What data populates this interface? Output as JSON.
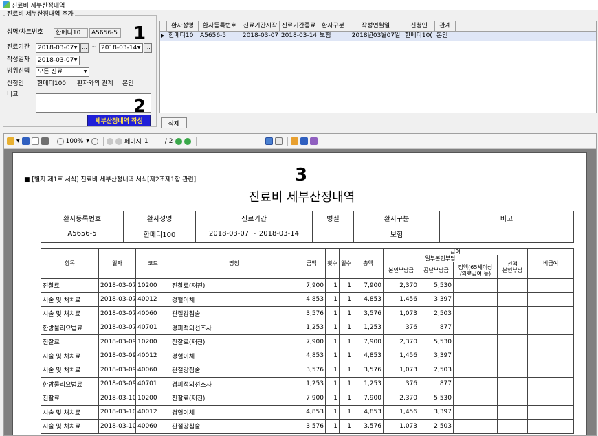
{
  "window": {
    "title": "진료비 세부산정내역"
  },
  "group": {
    "title": "진료비 세부산정내역 추가"
  },
  "form": {
    "name_label": "성명/차트번호",
    "name_value": "한메디10",
    "chart_value": "A5656-5",
    "period_label": "진료기간",
    "period_start": "2018-03-07",
    "period_sep": "~",
    "period_end": "2018-03-14",
    "ellipsis": "...",
    "write_date_label": "작성일자",
    "write_date": "2018-03-07",
    "scope_label": "범위선택",
    "scope_value": "모든 진료",
    "applicant_label": "신청인",
    "applicant_value": "한메디100",
    "relation_label": "환자와의 관계",
    "relation_value": "본인",
    "remark_label": "비고",
    "create_button": "세부산정내역 작성"
  },
  "markers": {
    "m1": "1",
    "m2": "2",
    "m3": "3"
  },
  "grid": {
    "headers": [
      "환자성명",
      "환자등록번호",
      "진료기간시작",
      "진료기간종료",
      "환자구분",
      "작성연월일",
      "신청인",
      "관계"
    ],
    "row": [
      "한메디10",
      "A5656-5",
      "2018-03-07",
      "2018-03-14",
      "보험",
      "2018년03월07일",
      "한메디10(",
      "본인"
    ]
  },
  "delete_button": "삭제",
  "toolbar": {
    "zoom": "100%",
    "page_label": "페이지",
    "page_current": "1",
    "page_total": "/ 2"
  },
  "report": {
    "form_note": "■ [별지 제1호 서식] 진료비 세부산정내역 서식[제2조제1항 관련]",
    "title": "진료비 세부산정내역",
    "info_headers": [
      "환자등록번호",
      "환자성명",
      "진료기간",
      "병실",
      "환자구분",
      "비고"
    ],
    "info_values": [
      "A5656-5",
      "한메디100",
      "2018-03-07 ~ 2018-03-14",
      "",
      "보험",
      ""
    ],
    "detail_headers": {
      "item": "항목",
      "date": "일자",
      "code": "코드",
      "name": "명칭",
      "amount": "금액",
      "count": "횟수",
      "days": "일수",
      "total": "총액",
      "benefit": "급여",
      "copay": "일부본인부담",
      "self_pay": "본인부담금",
      "insurer_pay": "공단부담금",
      "fixed_amount_l1": "정액(65세이상",
      "fixed_amount_l2": "/의료급여 등)",
      "full_self_l1": "전액",
      "full_self_l2": "본인부담",
      "non_benefit": "비급여"
    },
    "rows": [
      {
        "item": "진찰료",
        "date": "2018-03-07",
        "code": "10200",
        "name": "진찰료(재진)",
        "amount": "7,900",
        "count": "1",
        "days": "1",
        "total": "7,900",
        "self": "2,370",
        "insurer": "5,530"
      },
      {
        "item": "시술 및 처치료",
        "date": "2018-03-07",
        "code": "40012",
        "name": "경혈이체",
        "amount": "4,853",
        "count": "1",
        "days": "1",
        "total": "4,853",
        "self": "1,456",
        "insurer": "3,397"
      },
      {
        "item": "시술 및 처치료",
        "date": "2018-03-07",
        "code": "40060",
        "name": "관절강침술",
        "amount": "3,576",
        "count": "1",
        "days": "1",
        "total": "3,576",
        "self": "1,073",
        "insurer": "2,503"
      },
      {
        "item": "한방물리요법료",
        "date": "2018-03-07",
        "code": "40701",
        "name": "경피적외선조사",
        "amount": "1,253",
        "count": "1",
        "days": "1",
        "total": "1,253",
        "self": "376",
        "insurer": "877"
      },
      {
        "item": "진찰료",
        "date": "2018-03-09",
        "code": "10200",
        "name": "진찰료(재진)",
        "amount": "7,900",
        "count": "1",
        "days": "1",
        "total": "7,900",
        "self": "2,370",
        "insurer": "5,530"
      },
      {
        "item": "시술 및 처치료",
        "date": "2018-03-09",
        "code": "40012",
        "name": "경혈이체",
        "amount": "4,853",
        "count": "1",
        "days": "1",
        "total": "4,853",
        "self": "1,456",
        "insurer": "3,397"
      },
      {
        "item": "시술 및 처치료",
        "date": "2018-03-09",
        "code": "40060",
        "name": "관절강침술",
        "amount": "3,576",
        "count": "1",
        "days": "1",
        "total": "3,576",
        "self": "1,073",
        "insurer": "2,503"
      },
      {
        "item": "한방물리요법료",
        "date": "2018-03-09",
        "code": "40701",
        "name": "경피적외선조사",
        "amount": "1,253",
        "count": "1",
        "days": "1",
        "total": "1,253",
        "self": "376",
        "insurer": "877"
      },
      {
        "item": "진찰료",
        "date": "2018-03-10",
        "code": "10200",
        "name": "진찰료(재진)",
        "amount": "7,900",
        "count": "1",
        "days": "1",
        "total": "7,900",
        "self": "2,370",
        "insurer": "5,530"
      },
      {
        "item": "시술 및 처치료",
        "date": "2018-03-10",
        "code": "40012",
        "name": "경혈이체",
        "amount": "4,853",
        "count": "1",
        "days": "1",
        "total": "4,853",
        "self": "1,456",
        "insurer": "3,397"
      },
      {
        "item": "시술 및 처치료",
        "date": "2018-03-10",
        "code": "40060",
        "name": "관절강침술",
        "amount": "3,576",
        "count": "1",
        "days": "1",
        "total": "3,576",
        "self": "1,073",
        "insurer": "2,503"
      }
    ]
  }
}
